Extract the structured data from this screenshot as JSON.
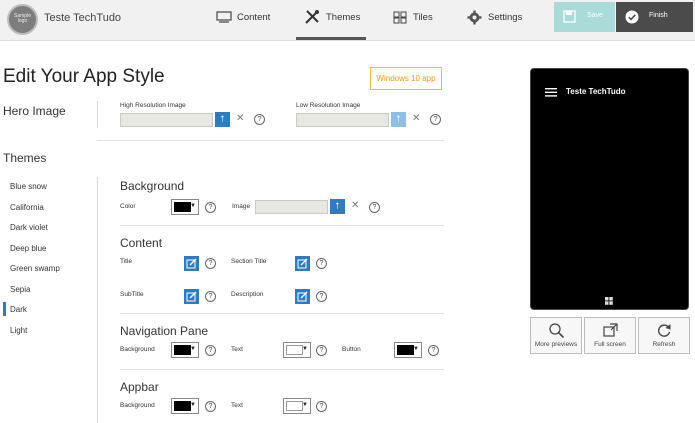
{
  "header": {
    "logo_text": "Sample logo",
    "app_title": "Teste TechTudo",
    "nav": [
      {
        "label": "Content"
      },
      {
        "label": "Themes"
      },
      {
        "label": "Tiles"
      },
      {
        "label": "Settings"
      }
    ],
    "save_label": "Save",
    "finish_label": "Finish"
  },
  "page": {
    "title": "Edit Your App Style",
    "platform_badge": "Windows 10 app"
  },
  "hero": {
    "title": "Hero Image",
    "high_res_label": "High Resolution Image",
    "low_res_label": "Low Resolution Image"
  },
  "themes": {
    "title": "Themes",
    "items": [
      "Blue snow",
      "California",
      "Dark violet",
      "Deep blue",
      "Green swamp",
      "Sepia",
      "Dark",
      "Light"
    ],
    "selected": "Dark"
  },
  "background": {
    "title": "Background",
    "color_label": "Color",
    "image_label": "Image",
    "color": "#000000"
  },
  "content": {
    "title": "Content",
    "title_label": "Title",
    "section_title_label": "Section Title",
    "subtitle_label": "SubTitle",
    "description_label": "Description"
  },
  "navigation_pane": {
    "title": "Navigation Pane",
    "background_label": "Background",
    "text_label": "Text",
    "button_label": "Button",
    "background_color": "#000000",
    "text_color": "#ffffff",
    "button_color": "#000000"
  },
  "appbar": {
    "title": "Appbar",
    "background_label": "Background",
    "text_label": "Text",
    "background_color": "#000000",
    "text_color": "#ffffff"
  },
  "preview": {
    "app_title": "Teste TechTudo",
    "buttons": [
      {
        "label": "More previews",
        "icon": "magnifier-icon"
      },
      {
        "label": "Full screen",
        "icon": "fullscreen-icon"
      },
      {
        "label": "Refresh",
        "icon": "refresh-icon"
      }
    ]
  },
  "colors": {
    "accent": "#2c7cc4",
    "save": "#a9dcd8",
    "finish": "#4b4b4b",
    "badge": "#f5b74a"
  }
}
